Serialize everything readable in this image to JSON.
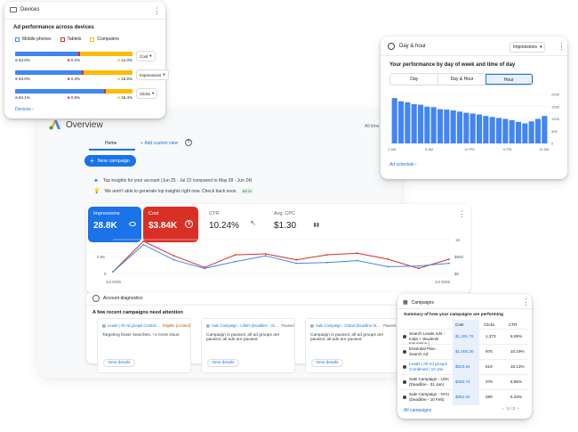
{
  "colors": {
    "blue": "#4285f4",
    "accent": "#1a73e8",
    "red": "#d93025",
    "yellow": "#fbbc04",
    "green": "#188038"
  },
  "devices": {
    "title": "Devices",
    "subtitle": "Ad performance across devices",
    "legend": [
      "Mobile phones",
      "Tablets",
      "Computers"
    ],
    "rows": [
      {
        "mobile": "53.0%",
        "tablet": "0.2%",
        "computer": "41.0%",
        "metric": "Cost",
        "mobile_share": 0.53,
        "tablet_share": 0.002,
        "computer_share": 0.41
      },
      {
        "mobile": "63.0%",
        "tablet": "0.3%",
        "computer": "16.5%",
        "metric": "Impressions",
        "mobile_share": 0.63,
        "tablet_share": 0.003,
        "computer_share": 0.165
      },
      {
        "mobile": "84.1%",
        "tablet": "0.5%",
        "computer": "15.4%",
        "metric": "Clicks",
        "mobile_share": 0.841,
        "tablet_share": 0.005,
        "computer_share": 0.154
      }
    ],
    "link": "Devices"
  },
  "dayhour": {
    "title": "Day & hour",
    "dropdown": "Impressions",
    "subtitle": "Your performance by day of week and time of day",
    "tabs": [
      "Day",
      "Day & Hour",
      "Hour"
    ],
    "active_tab": "Hour",
    "link": "Ad schedule",
    "chart_data": {
      "type": "bar",
      "x_ticks": [
        "12 AM",
        "6 AM",
        "12 PM",
        "6 PM",
        "12 AM"
      ],
      "y_ticks": [
        "200K",
        "150K",
        "100K",
        "50K",
        "0"
      ],
      "ylim": [
        0,
        200000
      ],
      "values": [
        185000,
        172000,
        168000,
        160000,
        158000,
        150000,
        148000,
        140000,
        138000,
        135000,
        130000,
        125000,
        122000,
        118000,
        112000,
        108000,
        104000,
        100000,
        95000,
        88000,
        82000,
        90000,
        100000,
        112000
      ]
    }
  },
  "overview": {
    "title": "Overview",
    "range": "All time",
    "tabs": [
      "Home",
      "Add custom view"
    ],
    "new_campaign": "New campaign",
    "insight1": "Top insights for your account (Jun 25 - Jul 22 compared to May 28 - Jun 24)",
    "insight2": "We aren't able to generate top insights right now. Check back soon.",
    "insight2_badge": "BETA",
    "metrics": [
      {
        "label": "Impressions",
        "value": "28.8K",
        "icon": "eye-icon"
      },
      {
        "label": "Cost",
        "value": "$3.84K",
        "icon": "dollar-icon"
      },
      {
        "label": "CTR",
        "value": "10.24%",
        "icon": "cursor-icon"
      },
      {
        "label": "Avg. CPC",
        "value": "$1.30",
        "icon": "bar-chart-icon"
      }
    ],
    "chart_data": {
      "type": "line",
      "x_ticks": [
        "Jul 2025",
        "Jul 2026"
      ],
      "y_left_ticks": [
        "1K",
        "0.5K",
        "0"
      ],
      "y_right_ticks": [
        "1K",
        "$500",
        "$0"
      ],
      "series": [
        {
          "color": "#d93025",
          "values": [
            0.05,
            0.95,
            0.52,
            0.18,
            0.55,
            0.58,
            0.4,
            0.55,
            0.6,
            0.42,
            0.15,
            0.42
          ]
        },
        {
          "color": "#4285f4",
          "values": [
            0.05,
            0.85,
            0.4,
            0.15,
            0.35,
            0.52,
            0.3,
            0.32,
            0.38,
            0.2,
            0.22,
            0.3
          ]
        }
      ]
    },
    "diag_title": "Account diagnostics",
    "diag_sub": "A few recent campaigns need attention",
    "campaigns": [
      {
        "name": "Leads | All Ad groups Combin…",
        "status": "Eligible (Limited)",
        "desc": "Targeting fewer searches, +1 more issue",
        "link": "View details"
      },
      {
        "name": "Sale Campaign - Lifetm (Deadline - 31…",
        "status": "Paused",
        "desc": "Campaign is paused, all ad groups are paused, all ads are paused",
        "link": "View details"
      },
      {
        "name": "Sale Campaign - Grand (Deadline 31…",
        "status": "Paused",
        "desc": "Campaign is paused, all ad groups are paused, all ads are paused",
        "link": "View details"
      }
    ]
  },
  "campaigns": {
    "title": "Campaigns",
    "subtitle": "Summary of how your campaigns are performing",
    "headers": [
      "Cost",
      "Clicks",
      "CTR"
    ],
    "rows": [
      {
        "name": "Search Leads Ads - India + Students Insurance (…",
        "cost": "$1,391.70",
        "clicks": "1,373",
        "ctr": "8.08%"
      },
      {
        "name": "Essential Plan - Search Ad",
        "cost": "$1,000.30",
        "clicks": "976",
        "ctr": "10.19%"
      },
      {
        "name": "Leads | All Ad groups Combined | 10 Jan",
        "cost": "$523.54",
        "clicks": "619",
        "ctr": "16.13%"
      },
      {
        "name": "Sale Campaign - USC (Deadline - 31 Jan)",
        "cost": "$480.74",
        "clicks": "378",
        "ctr": "8.85%"
      },
      {
        "name": "Sale Campaign - NYU (Deadline - 10 Feb)",
        "cost": "$361.04",
        "clicks": "289",
        "ctr": "6.33%"
      }
    ],
    "link": "All campaigns",
    "pager": "1 / 3"
  }
}
